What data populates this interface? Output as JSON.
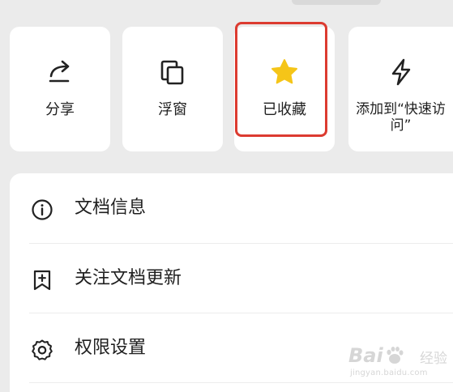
{
  "actions": [
    {
      "id": "share",
      "label": "分享",
      "icon": "share-icon"
    },
    {
      "id": "float",
      "label": "浮窗",
      "icon": "floating-window-icon"
    },
    {
      "id": "favorite",
      "label": "已收藏",
      "icon": "star-icon",
      "selected": true
    },
    {
      "id": "quick",
      "label": "添加到“快速访问”",
      "icon": "lightning-icon"
    }
  ],
  "menu": [
    {
      "id": "doc-info",
      "label": "文档信息",
      "icon": "info-icon"
    },
    {
      "id": "follow",
      "label": "关注文档更新",
      "icon": "bookmark-plus-icon"
    },
    {
      "id": "permissions",
      "label": "权限设置",
      "icon": "gear-icon"
    }
  ],
  "watermark": {
    "brand": "Bai",
    "suffix": "经验",
    "url": "jingyan.baidu.com"
  },
  "colors": {
    "star": "#f5c518",
    "highlight": "#dc3b30",
    "background": "#ebebeb"
  }
}
